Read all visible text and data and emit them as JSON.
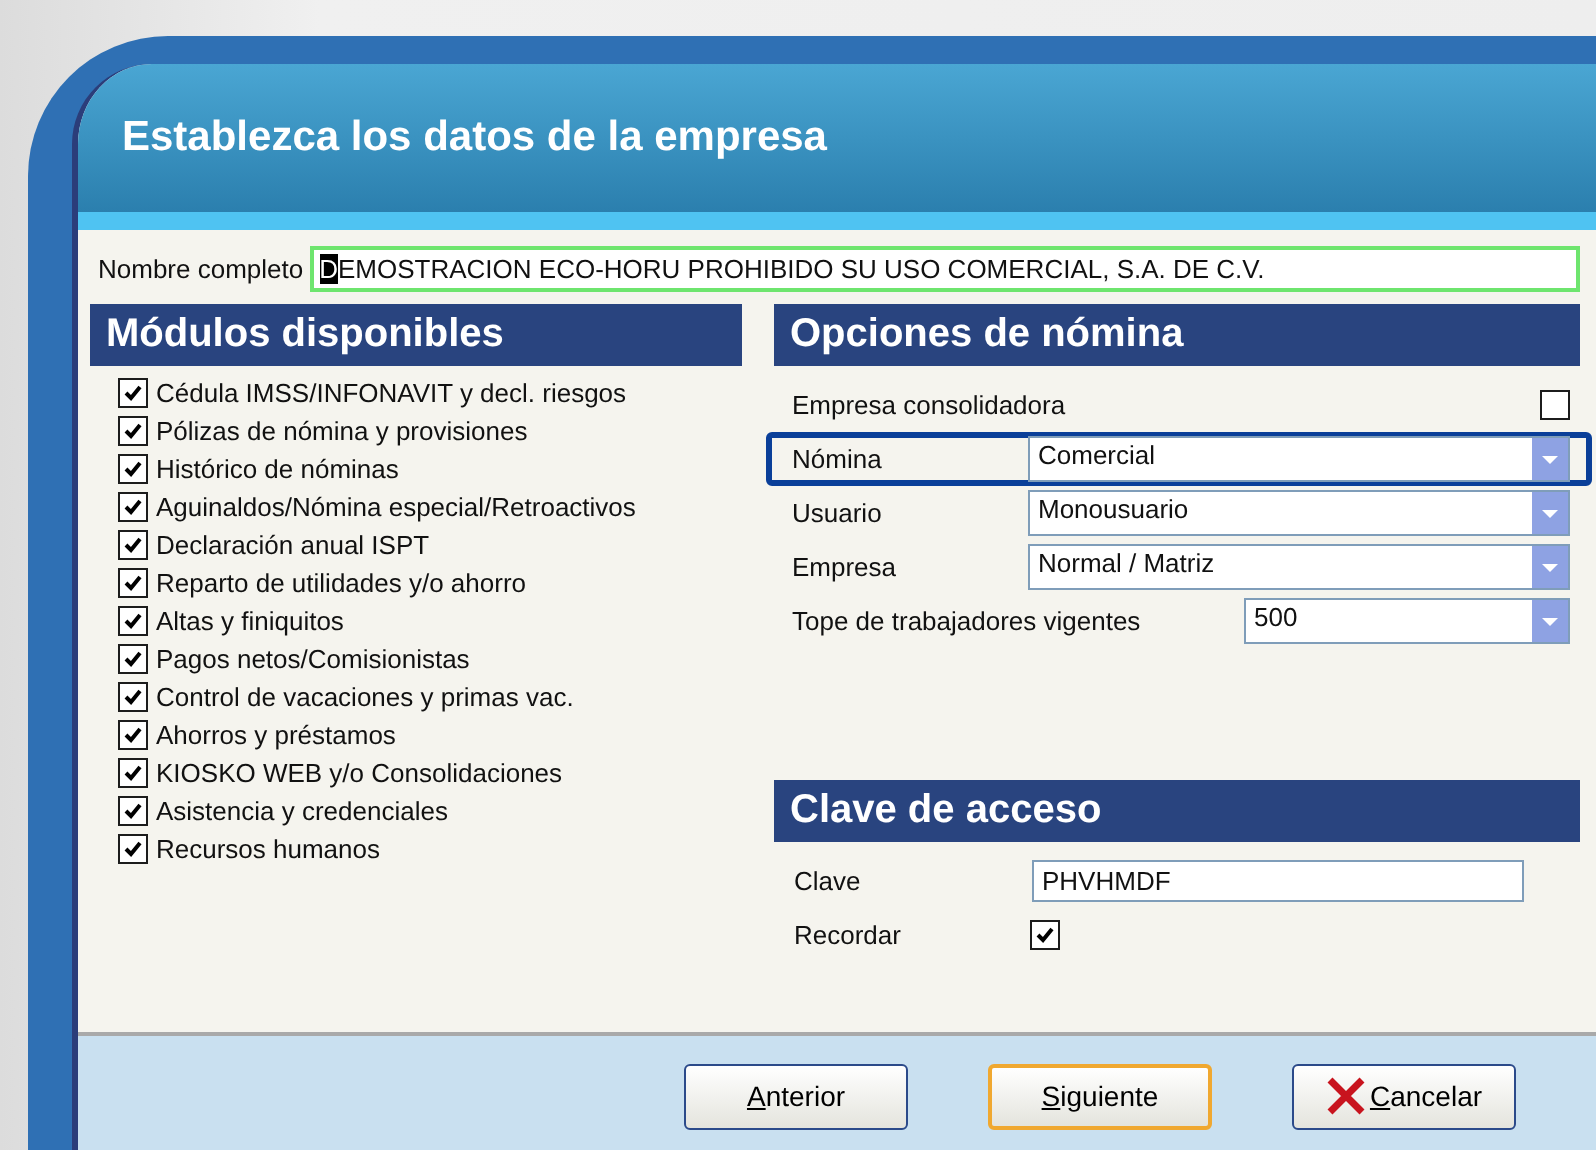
{
  "window": {
    "title": "Establezca los datos de la empresa"
  },
  "name_field": {
    "label": "Nombre completo",
    "value": "DEMOSTRACION ECO-HORU PROHIBIDO SU USO COMERCIAL, S.A. DE C.V."
  },
  "modules": {
    "title": "Módulos disponibles",
    "items": [
      {
        "label": "Cédula IMSS/INFONAVIT y decl. riesgos",
        "checked": true
      },
      {
        "label": "Pólizas de nómina y provisiones",
        "checked": true
      },
      {
        "label": "Histórico de nóminas",
        "checked": true
      },
      {
        "label": "Aguinaldos/Nómina especial/Retroactivos",
        "checked": true
      },
      {
        "label": "Declaración anual ISPT",
        "checked": true
      },
      {
        "label": "Reparto de utilidades y/o ahorro",
        "checked": true
      },
      {
        "label": "Altas y finiquitos",
        "checked": true
      },
      {
        "label": "Pagos netos/Comisionistas",
        "checked": true
      },
      {
        "label": "Control de vacaciones y primas vac.",
        "checked": true
      },
      {
        "label": "Ahorros y préstamos",
        "checked": true
      },
      {
        "label": "KIOSKO WEB y/o Consolidaciones",
        "checked": true
      },
      {
        "label": "Asistencia y credenciales",
        "checked": true
      },
      {
        "label": "Recursos humanos",
        "checked": true
      }
    ]
  },
  "payroll_options": {
    "title": "Opciones de nómina",
    "rows": [
      {
        "kind": "checkbox",
        "label": "Empresa consolidadora",
        "checked": false,
        "highlighted": false
      },
      {
        "kind": "dropdown",
        "label": "Nómina",
        "value": "Comercial",
        "highlighted": true
      },
      {
        "kind": "dropdown",
        "label": "Usuario",
        "value": "Monousuario",
        "highlighted": false
      },
      {
        "kind": "dropdown",
        "label": "Empresa",
        "value": "Normal / Matriz",
        "highlighted": false
      },
      {
        "kind": "short_dropdown",
        "label": "Tope de trabajadores vigentes",
        "value": "500",
        "highlighted": false
      }
    ]
  },
  "access": {
    "title": "Clave de acceso",
    "key_label": "Clave",
    "key_value": "PHVHMDF",
    "remember_label": "Recordar",
    "remember_checked": true
  },
  "buttons": [
    {
      "label": "Anterior",
      "kind": "plain",
      "default": false
    },
    {
      "label": "Siguiente",
      "kind": "plain",
      "default": true
    },
    {
      "label": "Cancelar",
      "kind": "cancel",
      "default": false
    }
  ]
}
